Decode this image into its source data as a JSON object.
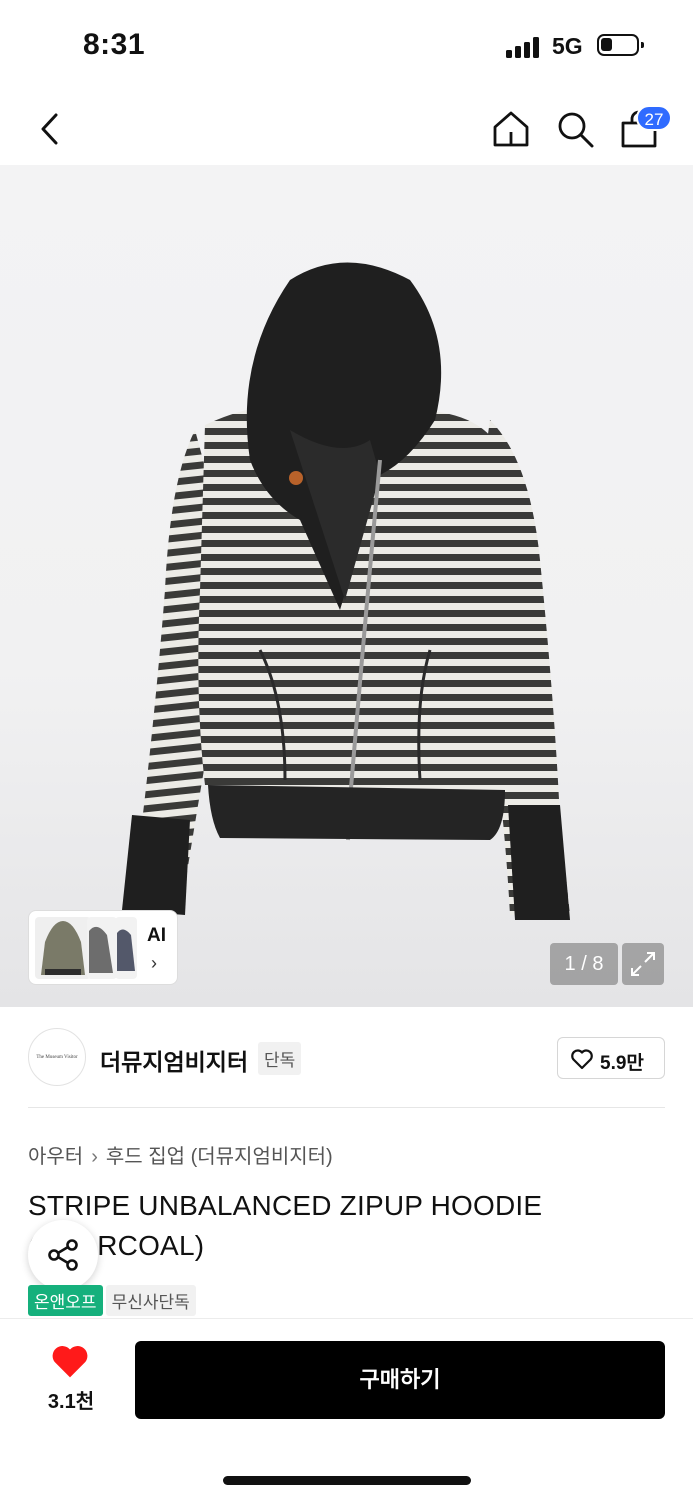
{
  "status_bar": {
    "time": "8:31",
    "network": "5G"
  },
  "nav": {
    "cart_count": "27"
  },
  "gallery": {
    "page_counter": "1 / 8",
    "ai_label": "AI",
    "ai_chevron": "›"
  },
  "brand": {
    "logo_text": "The Museum Visitor",
    "name": "더뮤지엄비지터",
    "exclusive_badge": "단독",
    "like_count": "5.9만"
  },
  "breadcrumb": {
    "category": "아우터",
    "separator": "›",
    "subcategory": "후드 집업 (더뮤지엄비지터)"
  },
  "product": {
    "title": "STRIPE UNBALANCED ZIPUP HOODIE (CHARCOAL)"
  },
  "tags": [
    "온앤오프",
    "무신사단독"
  ],
  "bottom_bar": {
    "wish_count": "3.1천",
    "buy_label": "구매하기"
  },
  "colors": {
    "accent_blue": "#2f6bff",
    "tag_green": "#15b07c",
    "heart_red": "#ff1a1a",
    "buy_button": "#000000"
  }
}
